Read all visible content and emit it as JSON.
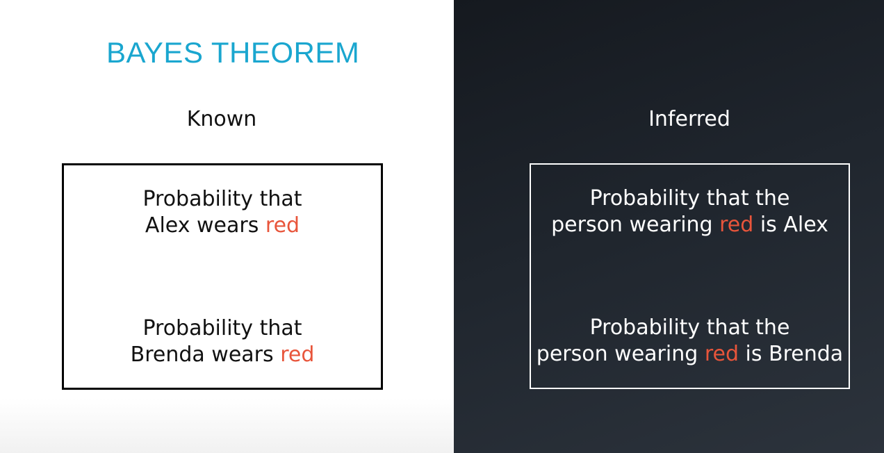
{
  "title": "BAYES THEOREM",
  "colors": {
    "title": "#1aa6cf",
    "highlight": "#e8553b",
    "left_bg": "#ffffff",
    "right_bg": "#1f252d"
  },
  "known": {
    "heading": "Known",
    "items": [
      {
        "line1": "Probability that",
        "line2_pre": "Alex wears ",
        "highlight": "red",
        "line2_post": ""
      },
      {
        "line1": "Probability that",
        "line2_pre": "Brenda wears ",
        "highlight": "red",
        "line2_post": ""
      }
    ]
  },
  "inferred": {
    "heading": "Inferred",
    "items": [
      {
        "line1": "Probability that the",
        "line2_pre": "person wearing ",
        "highlight": "red",
        "line2_post": " is Alex"
      },
      {
        "line1": "Probability that the",
        "line2_pre": "person wearing ",
        "highlight": "red",
        "line2_post": " is Brenda"
      }
    ]
  }
}
